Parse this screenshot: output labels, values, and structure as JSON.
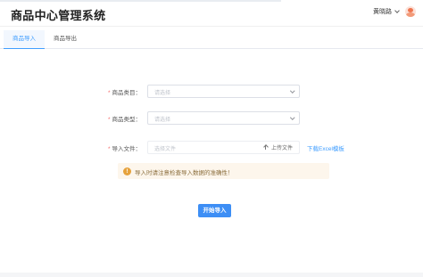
{
  "header": {
    "title": "商品中心管理系统",
    "user_name": "黄晓路",
    "avatar_color": "#ef7550"
  },
  "tabs": [
    {
      "label": "商品导入",
      "active": true
    },
    {
      "label": "商品导出",
      "active": false
    }
  ],
  "form": {
    "category": {
      "label": "商品类目：",
      "placeholder": "请选择",
      "required": true
    },
    "type": {
      "label": "商品类型：",
      "placeholder": "请选择",
      "required": true
    },
    "import_file": {
      "label": "导入文件：",
      "placeholder": "选择文件",
      "upload_label": "上传文件",
      "template_link": "下载Excel模板",
      "required": true
    },
    "required_mark": "*"
  },
  "alert": {
    "icon": "warning-icon",
    "icon_glyph": "!",
    "text": "导入时请注意检查导入数据的准确性！",
    "color": "#e6a23c"
  },
  "actions": {
    "start_label": "开始导入",
    "accent": "#409eff"
  }
}
